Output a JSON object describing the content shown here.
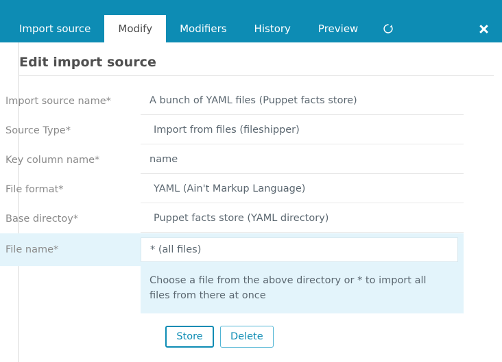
{
  "colors": {
    "accent": "#0d8cb4",
    "accent_light": "#4fb4d4",
    "focus_row_bg": "#e3f4fb",
    "label_text": "#8a8a8a",
    "value_text": "#5b6770",
    "title_text": "#4f4f4f"
  },
  "tabbar": {
    "tabs": [
      {
        "label": "Import source",
        "active": false
      },
      {
        "label": "Modify",
        "active": true
      },
      {
        "label": "Modifiers",
        "active": false
      },
      {
        "label": "History",
        "active": false
      },
      {
        "label": "Preview",
        "active": false
      }
    ],
    "refresh_icon": "refresh-icon",
    "close_icon": "close-icon"
  },
  "page": {
    "title": "Edit import source"
  },
  "form": {
    "fields": [
      {
        "label": "Import source name*",
        "value": "A bunch of YAML files (Puppet facts store)",
        "kind": "text",
        "focused": false
      },
      {
        "label": "Source Type*",
        "value": "Import from files (fileshipper)",
        "kind": "select",
        "focused": false
      },
      {
        "label": "Key column name*",
        "value": "name",
        "kind": "text",
        "focused": false
      },
      {
        "label": "File format*",
        "value": "YAML (Ain't Markup Language)",
        "kind": "select",
        "focused": false
      },
      {
        "label": "Base directoy*",
        "value": "Puppet facts store (YAML directory)",
        "kind": "select",
        "focused": false
      },
      {
        "label": "File name*",
        "value": "* (all files)",
        "kind": "select",
        "focused": true,
        "hint": "Choose a file from the above directory or * to import all files from there at once"
      }
    ]
  },
  "actions": {
    "store_label": "Store",
    "delete_label": "Delete"
  }
}
